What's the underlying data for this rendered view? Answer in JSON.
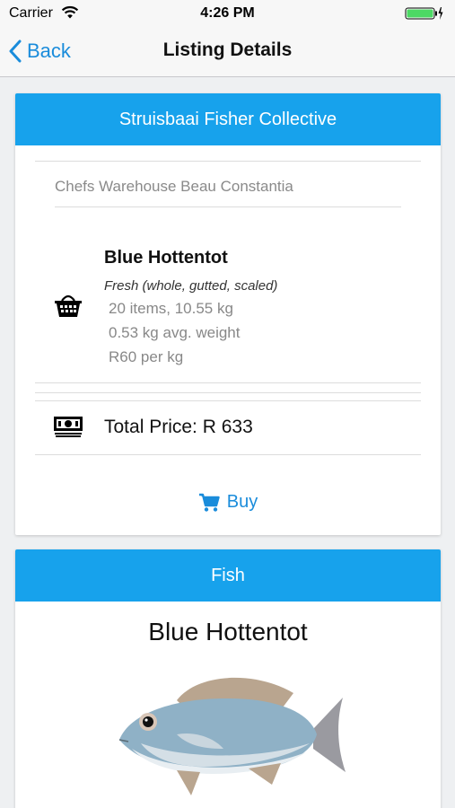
{
  "status_bar": {
    "carrier": "Carrier",
    "time": "4:26 PM"
  },
  "nav": {
    "back_label": "Back",
    "title": "Listing Details"
  },
  "listing": {
    "seller": "Struisbaai Fisher Collective",
    "buyer": "Chefs Warehouse Beau Constantia",
    "fish_name": "Blue Hottentot",
    "description": "Fresh (whole, gutted, scaled)",
    "items": "20 items, 10.55 kg",
    "avg_weight": "0.53 kg avg. weight",
    "price_per_kg": "R60 per kg",
    "total_price": "Total Price: R 633",
    "buy_label": "Buy"
  },
  "fish_card": {
    "header": "Fish",
    "name": "Blue Hottentot"
  },
  "colors": {
    "accent": "#17a2ec",
    "link": "#1a8cdb",
    "battery": "#4cd964"
  },
  "icons": [
    "wifi-icon",
    "battery-icon",
    "back-chevron-icon",
    "basket-icon",
    "money-icon",
    "cart-icon"
  ]
}
